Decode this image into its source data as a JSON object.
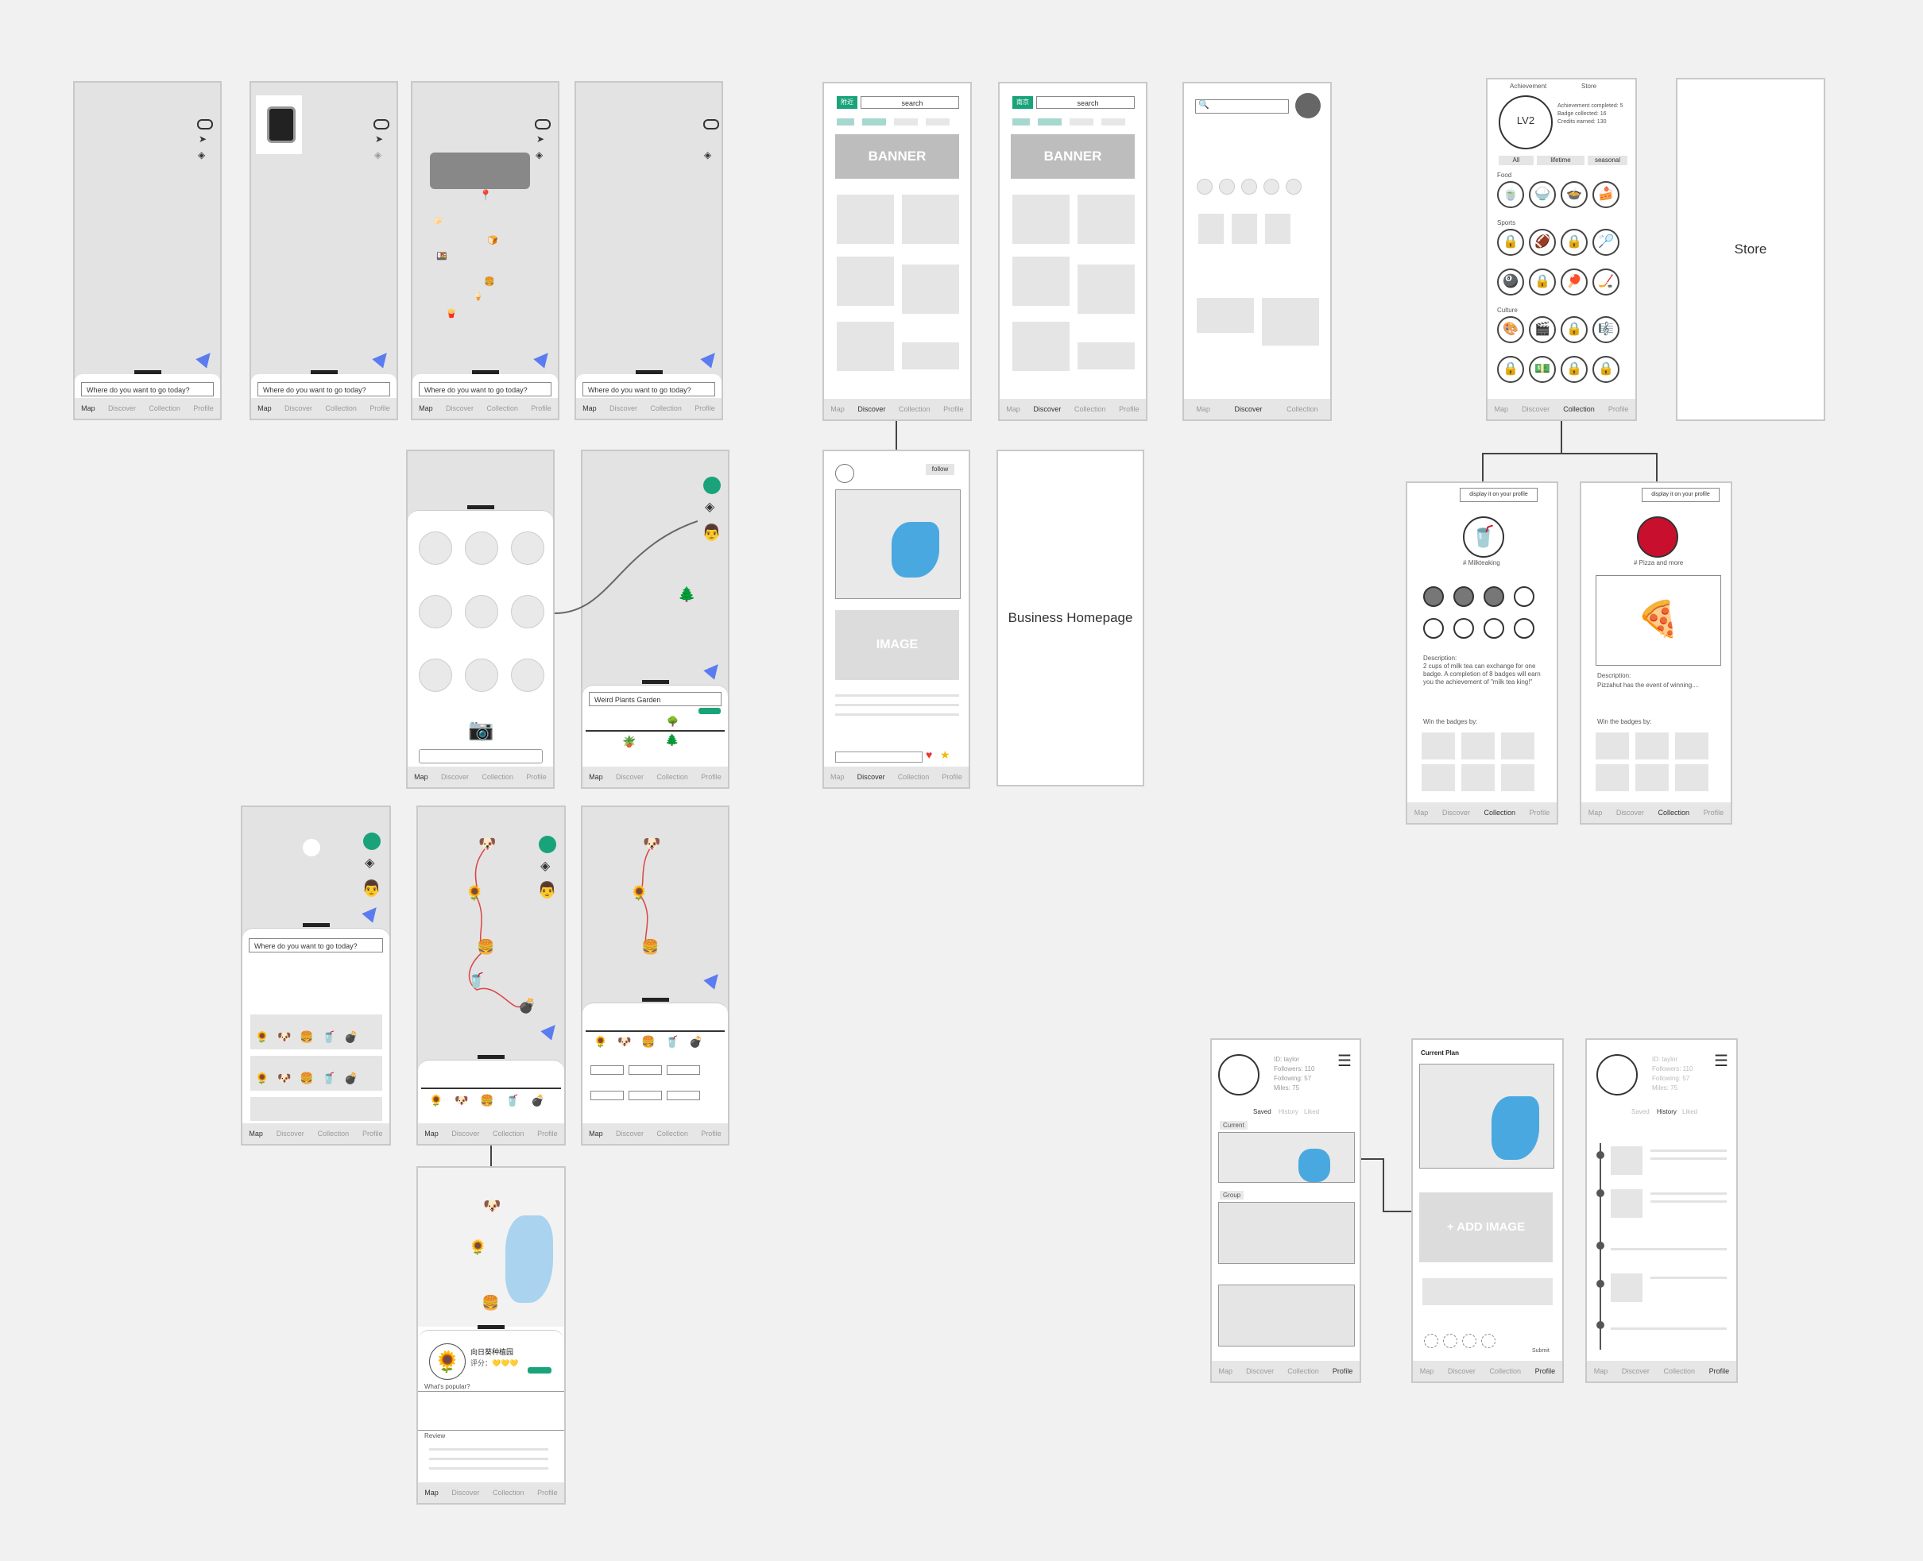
{
  "tabs": {
    "map": "Map",
    "discover": "Discover",
    "collection": "Collection",
    "profile": "Profile"
  },
  "map_screens": {
    "search_placeholder": "Where do you want to go today?"
  },
  "discover": {
    "search": "search",
    "banner": "BANNER",
    "image": "IMAGE",
    "follow": "follow",
    "tag1_a": "附近",
    "tag1_b": "南京"
  },
  "plants": {
    "place": "Weird Plants Garden"
  },
  "popular": {
    "place": "向日葵种植园",
    "rating": "评分：💛💛💛",
    "whats_popular": "What's popular?",
    "review": "Review"
  },
  "achievement": {
    "tab_achievement": "Achievement",
    "tab_store": "Store",
    "level": "LV2",
    "stats": [
      "Achievement completed: 5",
      "Badge collected: 16",
      "Credits earned: 130"
    ],
    "filters": [
      "All",
      "lifetime",
      "seasonal"
    ],
    "sections": [
      "Food",
      "Sports",
      "Culture"
    ]
  },
  "store": {
    "label": "Store"
  },
  "business": {
    "label": "Business Homepage"
  },
  "badge_detail_1": {
    "display": "display it on your profile",
    "name": "# Milkteaking",
    "desc_title": "Description:",
    "desc": "2 cups of milk tea can exchange for one badge. A completion of 8 badges will earn you the achievement of \"milk tea king!\"",
    "win": "Win the badges by:"
  },
  "badge_detail_2": {
    "display": "display it on your profile",
    "name": "# Pizza and more",
    "desc_title": "Description:",
    "desc": "Pizzahut has the event of winning....",
    "win": "Win the badges by:"
  },
  "profile": {
    "id": "ID: taylor",
    "followers": "Followers: 110",
    "following": "Following: 57",
    "miles": "Miles: 75",
    "tabs": [
      "Saved",
      "History",
      "Liked"
    ],
    "current": "Current",
    "group": "Group"
  },
  "plan": {
    "title": "Current Plan",
    "add": "+ ADD IMAGE",
    "submit": "Submit"
  }
}
